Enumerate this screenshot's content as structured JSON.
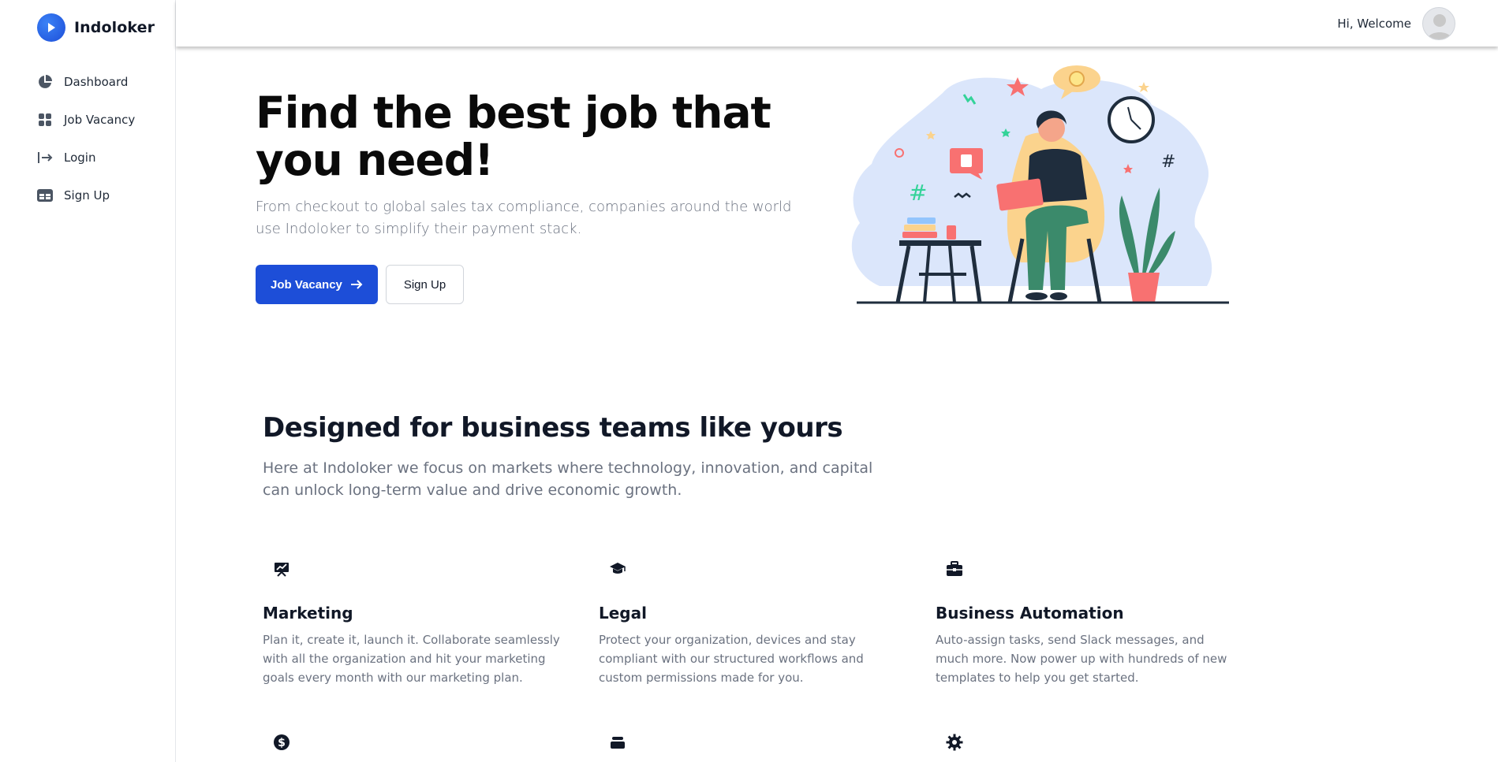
{
  "brand": {
    "name": "Indoloker",
    "color": "#1d4ed8"
  },
  "sidebar": {
    "items": [
      {
        "label": "Dashboard",
        "icon": "pie-chart-icon"
      },
      {
        "label": "Job Vacancy",
        "icon": "grid-icon"
      },
      {
        "label": "Login",
        "icon": "login-arrow-icon"
      },
      {
        "label": "Sign Up",
        "icon": "table-icon"
      }
    ]
  },
  "topbar": {
    "welcome": "Hi, Welcome",
    "avatar_icon": "user-avatar-icon"
  },
  "hero": {
    "title": "Find the best job that you need!",
    "subtitle": "From checkout to global sales tax compliance, companies around the world use Indoloker to simplify their payment stack.",
    "primary_button": "Job Vacancy",
    "secondary_button": "Sign Up",
    "accent": "#1d4ed8"
  },
  "features_section": {
    "title": "Designed for business teams like yours",
    "subtitle": "Here at Indoloker we focus on markets where technology, innovation, and capital can unlock long-term value and drive economic growth.",
    "items": [
      {
        "title": "Marketing",
        "icon": "presentation-chart-icon",
        "description": "Plan it, create it, launch it. Collaborate seamlessly with all the organization and hit your marketing goals every month with our marketing plan."
      },
      {
        "title": "Legal",
        "icon": "graduation-cap-icon",
        "description": "Protect your organization, devices and stay compliant with our structured workflows and custom permissions made for you."
      },
      {
        "title": "Business Automation",
        "icon": "briefcase-icon",
        "description": "Auto-assign tasks, send Slack messages, and much more. Now power up with hundreds of new templates to help you get started."
      }
    ],
    "row2_icons": [
      "dollar-coin-icon",
      "stack-icon",
      "gear-icon"
    ]
  }
}
